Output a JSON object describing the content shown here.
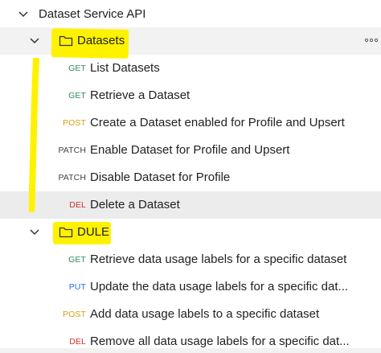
{
  "root": {
    "label": "Dataset Service API"
  },
  "folders": [
    {
      "name": "Datasets",
      "items": [
        {
          "method": "GET",
          "label": "List Datasets",
          "color": "#2e8b57"
        },
        {
          "method": "GET",
          "label": "Retrieve a Dataset",
          "color": "#2e8b57"
        },
        {
          "method": "POST",
          "label": "Create a Dataset enabled for Profile and Upsert",
          "color": "#d4a017"
        },
        {
          "method": "PATCH",
          "label": "Enable Dataset for Profile and Upsert",
          "color": "#444444"
        },
        {
          "method": "PATCH",
          "label": "Disable Dataset for Profile",
          "color": "#444444"
        },
        {
          "method": "DEL",
          "label": "Delete a Dataset",
          "color": "#d32f2f"
        }
      ]
    },
    {
      "name": "DULE",
      "items": [
        {
          "method": "GET",
          "label": "Retrieve data usage labels for a specific dataset",
          "color": "#2e8b57"
        },
        {
          "method": "PUT",
          "label": "Update the data usage labels for a specific dat...",
          "color": "#1e6fd9"
        },
        {
          "method": "POST",
          "label": "Add data usage labels to a specific dataset",
          "color": "#d4a017"
        },
        {
          "method": "DEL",
          "label": "Remove all data usage labels for a specific dat...",
          "color": "#d32f2f"
        }
      ]
    }
  ],
  "icons": {
    "chevron": "chevron-down-icon",
    "folder": "folder-icon",
    "more": "more-options-icon"
  },
  "colors": {
    "highlight": "#fff200",
    "folder_row_bg": "#f2f2f2",
    "selected_row_bg": "#ececec"
  }
}
